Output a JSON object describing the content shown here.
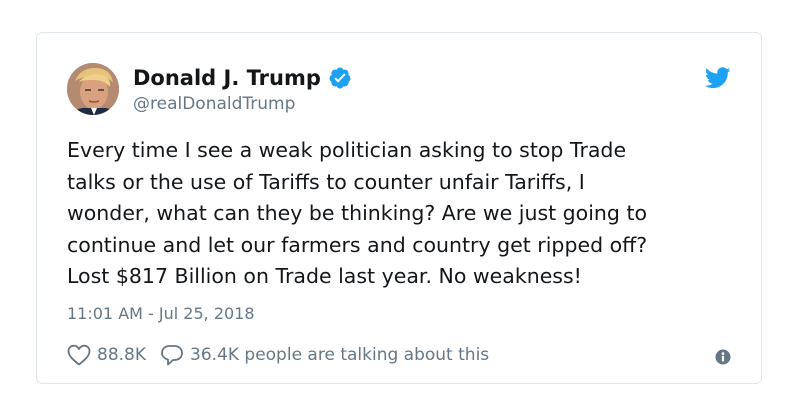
{
  "tweet": {
    "author_name": "Donald J. Trump",
    "author_handle": "@realDonaldTrump",
    "verified": true,
    "text": "Every time I see a weak politician asking to stop Trade\ntalks or the use of Tariffs to counter unfair Tariffs, I\nwonder, what can they be thinking? Are we just going to\ncontinue and let our farmers and country get ripped off?\nLost $817 Billion on Trade last year. No weakness!",
    "timestamp": "11:01 AM - Jul 25, 2018",
    "likes": "88.8K",
    "talking": "36.4K people are talking about this"
  },
  "icons": {
    "verified": "verified-badge-icon",
    "brand": "twitter-bird-icon",
    "like": "heart-icon",
    "reply": "speech-bubble-icon",
    "info": "info-icon"
  },
  "colors": {
    "accent": "#1da1f2",
    "text": "#14171a",
    "secondary": "#657786",
    "border": "#e1e8ed"
  }
}
